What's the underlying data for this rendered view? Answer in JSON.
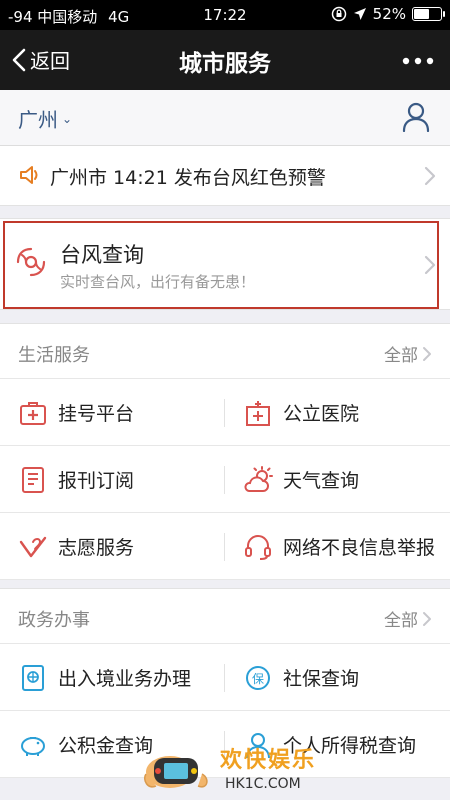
{
  "status_bar": {
    "signal": "-94",
    "carrier": "中国移动",
    "network": "4G",
    "time": "17:22",
    "battery": "52%",
    "battery_level": 0.52
  },
  "nav": {
    "back_label": "返回",
    "title": "城市服务",
    "more_icon": "more-dots-icon"
  },
  "city": {
    "name": "广州",
    "profile_icon": "user-icon"
  },
  "alert": {
    "text": "广州市 14:21 发布台风红色预警",
    "icon": "speaker-icon"
  },
  "typhoon": {
    "title": "台风查询",
    "subtitle": "实时查台风，出行有备无患！",
    "icon": "typhoon-icon",
    "highlight_color": "#c0392b"
  },
  "life_services": {
    "title": "生活服务",
    "all_label": "全部",
    "items": [
      {
        "label": "挂号平台",
        "icon": "medical-kit-icon"
      },
      {
        "label": "公立医院",
        "icon": "hospital-icon"
      },
      {
        "label": "报刊订阅",
        "icon": "newspaper-icon"
      },
      {
        "label": "天气查询",
        "icon": "weather-icon"
      },
      {
        "label": "志愿服务",
        "icon": "heart-hand-icon"
      },
      {
        "label": "网络不良信息举报",
        "icon": "headset-icon"
      }
    ]
  },
  "gov_services": {
    "title": "政务办事",
    "all_label": "全部",
    "items": [
      {
        "label": "出入境业务办理",
        "icon": "passport-icon"
      },
      {
        "label": "社保查询",
        "icon": "social-security-icon"
      },
      {
        "label": "公积金查询",
        "icon": "piggy-bank-icon"
      },
      {
        "label": "个人所得税查询",
        "icon": "person-icon"
      }
    ]
  },
  "watermark": {
    "title": "欢快娱乐",
    "url": "HK1C.COM"
  },
  "colors": {
    "life_icon": "#d9534f",
    "gov_icon": "#2a9fd6",
    "city_text": "#3a5a85"
  }
}
